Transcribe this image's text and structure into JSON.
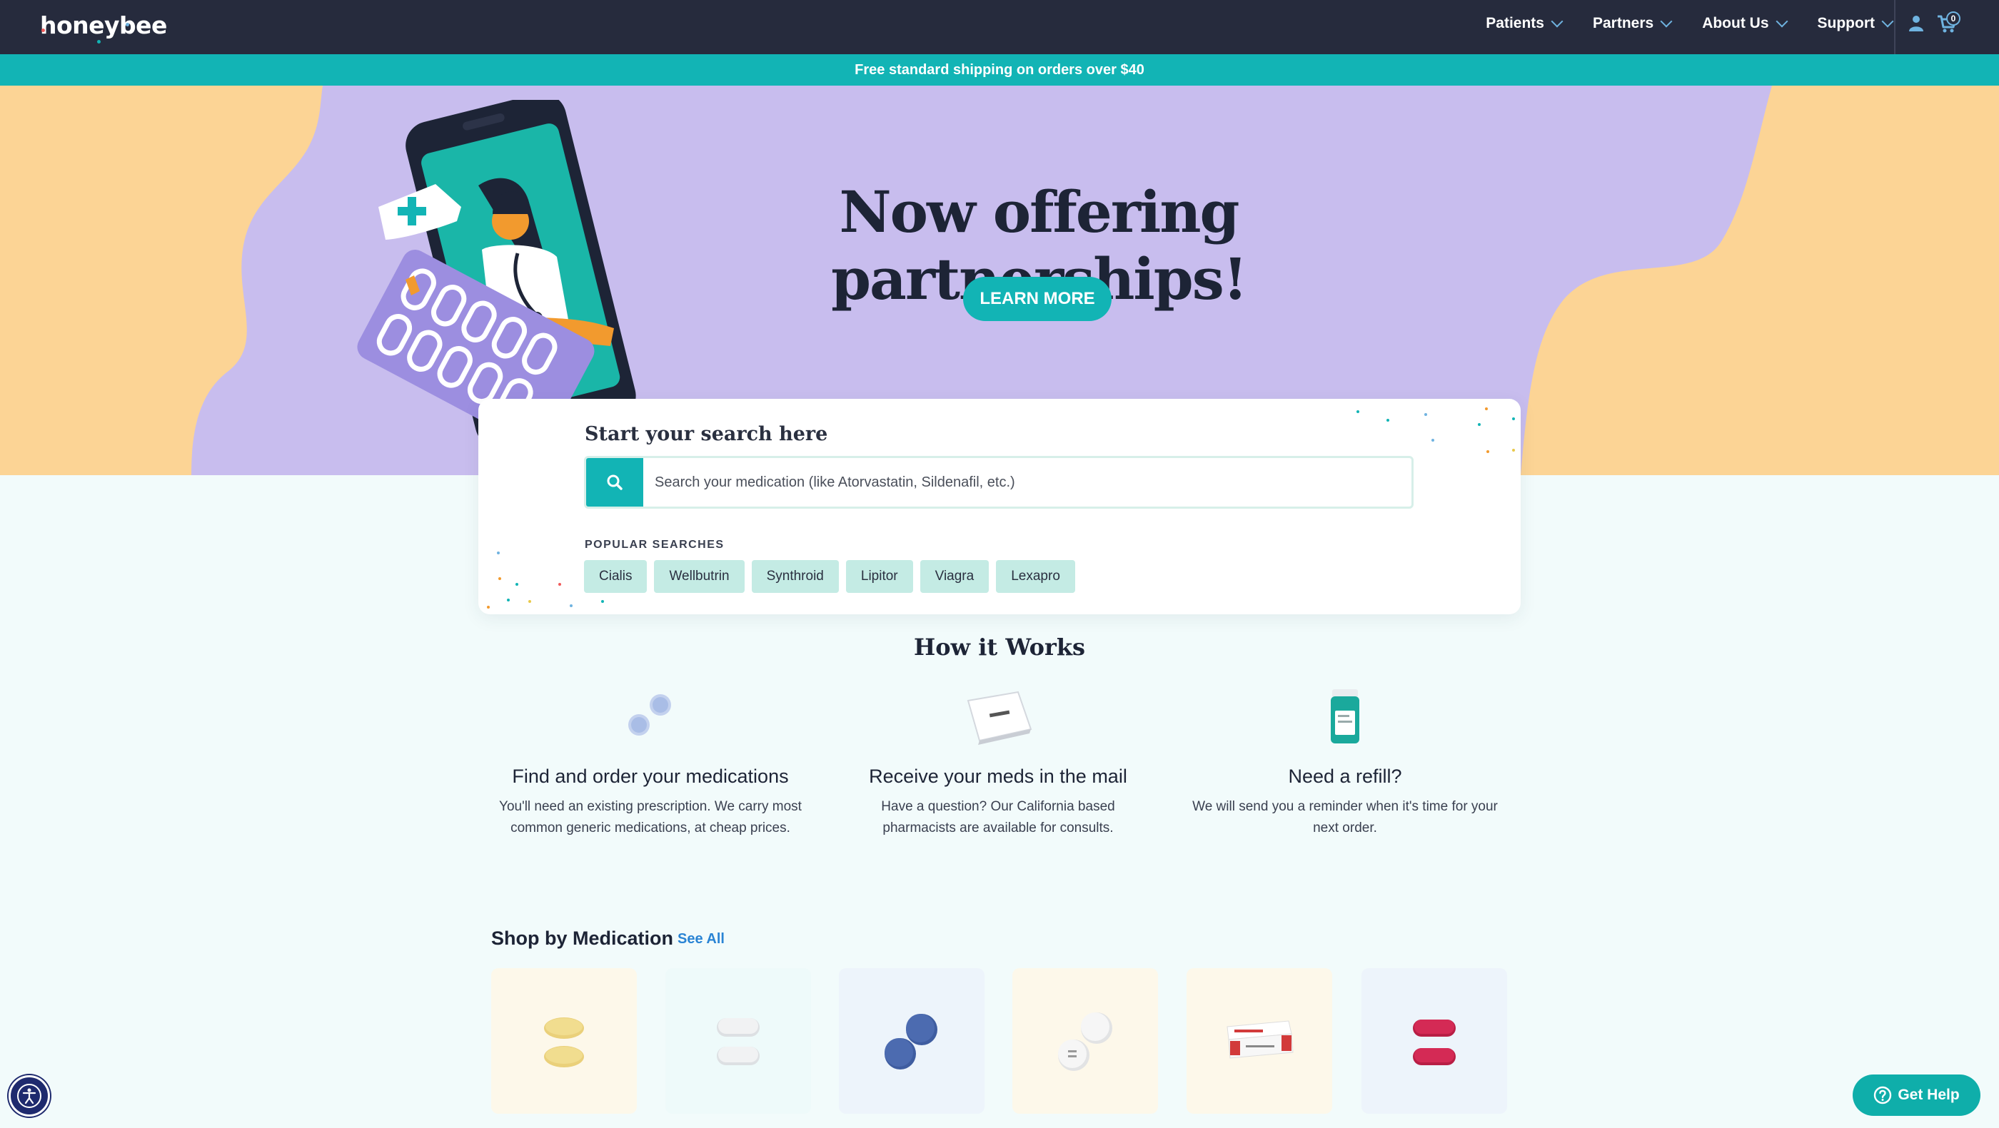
{
  "brand": {
    "logo_text": "honeybee"
  },
  "nav": {
    "items": [
      {
        "label": "Patients"
      },
      {
        "label": "Partners"
      },
      {
        "label": "About Us"
      },
      {
        "label": "Support"
      }
    ],
    "cart_count": "0"
  },
  "promo": {
    "text": "Free standard shipping on orders over $40"
  },
  "hero": {
    "title": "Now offering partnerships!",
    "cta_label": "LEARN MORE"
  },
  "search": {
    "heading": "Start your search here",
    "placeholder": "Search your medication (like Atorvastatin, Sildenafil, etc.)",
    "popular_label": "POPULAR SEARCHES",
    "popular": [
      "Cialis",
      "Wellbutrin",
      "Synthroid",
      "Lipitor",
      "Viagra",
      "Lexapro"
    ]
  },
  "how": {
    "title": "How it Works",
    "steps": [
      {
        "title": "Find and order your medications",
        "desc": "You'll need an existing prescription. We carry most common generic medications, at cheap prices."
      },
      {
        "title": "Receive your meds in the mail",
        "desc": "Have a question? Our California based pharmacists are available for consults."
      },
      {
        "title": "Need a refill?",
        "desc": "We will send you a reminder when it's time for your next order."
      }
    ]
  },
  "shop": {
    "title": "Shop by Medication",
    "see_all": "See All",
    "card_colors": [
      "#fdf8ea",
      "#eefafa",
      "#edf4fb",
      "#fdf8ea",
      "#fdf8ea",
      "#edf4fb"
    ]
  },
  "support": {
    "help_label": "Get Help"
  },
  "colors": {
    "navy": "#262b3d",
    "teal": "#12b4b5",
    "lavender": "#c8bdee",
    "peach": "#fcd495"
  }
}
